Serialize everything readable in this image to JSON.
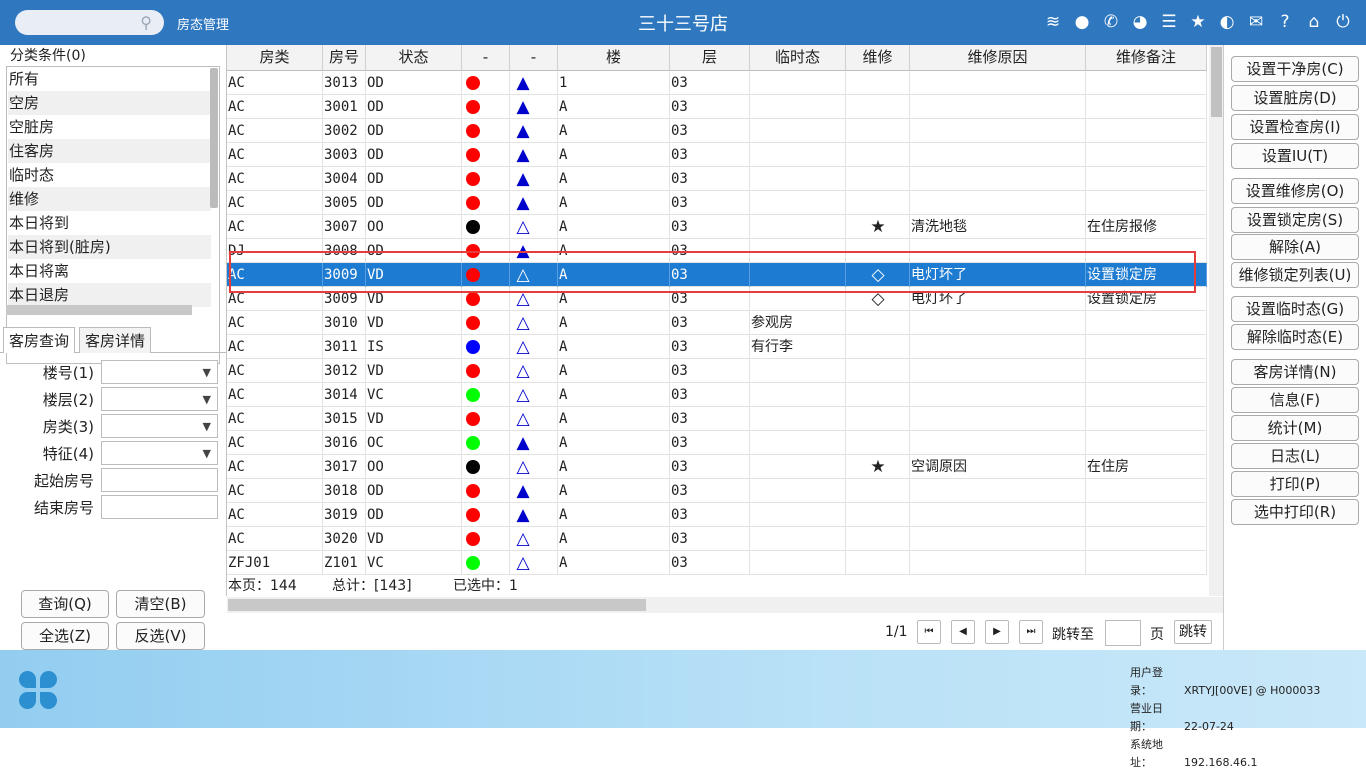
{
  "topbar": {
    "search_placeholder": "",
    "module": "房态管理",
    "store_name": "三十三号店",
    "icons": [
      "wifi-icon",
      "chat-icon",
      "phone-icon",
      "palette-icon",
      "menu-icon",
      "star-icon",
      "theme-icon",
      "mail-icon",
      "help-icon",
      "home-icon",
      "power-icon"
    ]
  },
  "categories": {
    "title": "分类条件(0)",
    "items": [
      "所有",
      "空房",
      "空脏房",
      "住客房",
      "临时态",
      "维修",
      "本日将到",
      "本日将到(脏房)",
      "本日将离",
      "本日退房"
    ]
  },
  "tabs": [
    "客房查询",
    "客房详情"
  ],
  "filters": {
    "building": "楼号(1)",
    "floor": "楼层(2)",
    "room_type": "房类(3)",
    "feature": "特征(4)",
    "start_room": "起始房号",
    "end_room": "结束房号"
  },
  "buttons": {
    "query": "查询(Q)",
    "clear": "清空(B)",
    "select_all": "全选(Z)",
    "invert": "反选(V)"
  },
  "grid": {
    "columns": [
      "房类",
      "房号",
      "状态",
      "-",
      "-",
      "楼",
      "层",
      "临时态",
      "维修",
      "维修原因",
      "维修备注"
    ],
    "rows": [
      {
        "type": "AC",
        "room": "3013",
        "status": "OD",
        "dot": "#ff0000",
        "tri": "filled",
        "bld": "1",
        "floor": "03",
        "temp": "",
        "repair": "",
        "reason": "",
        "note": ""
      },
      {
        "type": "AC",
        "room": "3001",
        "status": "OD",
        "dot": "#ff0000",
        "tri": "filled",
        "bld": "A",
        "floor": "03",
        "temp": "",
        "repair": "",
        "reason": "",
        "note": ""
      },
      {
        "type": "AC",
        "room": "3002",
        "status": "OD",
        "dot": "#ff0000",
        "tri": "filled",
        "bld": "A",
        "floor": "03",
        "temp": "",
        "repair": "",
        "reason": "",
        "note": ""
      },
      {
        "type": "AC",
        "room": "3003",
        "status": "OD",
        "dot": "#ff0000",
        "tri": "filled",
        "bld": "A",
        "floor": "03",
        "temp": "",
        "repair": "",
        "reason": "",
        "note": ""
      },
      {
        "type": "AC",
        "room": "3004",
        "status": "OD",
        "dot": "#ff0000",
        "tri": "filled",
        "bld": "A",
        "floor": "03",
        "temp": "",
        "repair": "",
        "reason": "",
        "note": ""
      },
      {
        "type": "AC",
        "room": "3005",
        "status": "OD",
        "dot": "#ff0000",
        "tri": "filled",
        "bld": "A",
        "floor": "03",
        "temp": "",
        "repair": "",
        "reason": "",
        "note": ""
      },
      {
        "type": "AC",
        "room": "3007",
        "status": "OO",
        "dot": "#000000",
        "tri": "outline",
        "bld": "A",
        "floor": "03",
        "temp": "",
        "repair": "★",
        "reason": "清洗地毯",
        "note": "在住房报修"
      },
      {
        "type": "DJ",
        "room": "3008",
        "status": "OD",
        "dot": "#ff0000",
        "tri": "filled",
        "bld": "A",
        "floor": "03",
        "temp": "",
        "repair": "",
        "reason": "",
        "note": ""
      },
      {
        "type": "AC",
        "room": "3009",
        "status": "VD",
        "dot": "#ff0000",
        "tri": "outline",
        "bld": "A",
        "floor": "03",
        "temp": "",
        "repair": "◇",
        "reason": "电灯坏了",
        "note": "设置锁定房",
        "selected": true
      },
      {
        "type": "AC",
        "room": "3009",
        "status": "VD",
        "dot": "#ff0000",
        "tri": "outline",
        "bld": "A",
        "floor": "03",
        "temp": "",
        "repair": "◇",
        "reason": "电灯坏了",
        "note": "设置锁定房"
      },
      {
        "type": "AC",
        "room": "3010",
        "status": "VD",
        "dot": "#ff0000",
        "tri": "outline",
        "bld": "A",
        "floor": "03",
        "temp": "参观房",
        "repair": "",
        "reason": "",
        "note": ""
      },
      {
        "type": "AC",
        "room": "3011",
        "status": "IS",
        "dot": "#0000ff",
        "tri": "outline",
        "bld": "A",
        "floor": "03",
        "temp": "有行李",
        "repair": "",
        "reason": "",
        "note": ""
      },
      {
        "type": "AC",
        "room": "3012",
        "status": "VD",
        "dot": "#ff0000",
        "tri": "outline",
        "bld": "A",
        "floor": "03",
        "temp": "",
        "repair": "",
        "reason": "",
        "note": ""
      },
      {
        "type": "AC",
        "room": "3014",
        "status": "VC",
        "dot": "#00ff00",
        "tri": "outline",
        "bld": "A",
        "floor": "03",
        "temp": "",
        "repair": "",
        "reason": "",
        "note": ""
      },
      {
        "type": "AC",
        "room": "3015",
        "status": "VD",
        "dot": "#ff0000",
        "tri": "outline",
        "bld": "A",
        "floor": "03",
        "temp": "",
        "repair": "",
        "reason": "",
        "note": ""
      },
      {
        "type": "AC",
        "room": "3016",
        "status": "OC",
        "dot": "#00ff00",
        "tri": "filled",
        "bld": "A",
        "floor": "03",
        "temp": "",
        "repair": "",
        "reason": "",
        "note": ""
      },
      {
        "type": "AC",
        "room": "3017",
        "status": "OO",
        "dot": "#000000",
        "tri": "outline",
        "bld": "A",
        "floor": "03",
        "temp": "",
        "repair": "★",
        "reason": "空调原因",
        "note": "在住房"
      },
      {
        "type": "AC",
        "room": "3018",
        "status": "OD",
        "dot": "#ff0000",
        "tri": "filled",
        "bld": "A",
        "floor": "03",
        "temp": "",
        "repair": "",
        "reason": "",
        "note": ""
      },
      {
        "type": "AC",
        "room": "3019",
        "status": "OD",
        "dot": "#ff0000",
        "tri": "filled",
        "bld": "A",
        "floor": "03",
        "temp": "",
        "repair": "",
        "reason": "",
        "note": ""
      },
      {
        "type": "AC",
        "room": "3020",
        "status": "VD",
        "dot": "#ff0000",
        "tri": "outline",
        "bld": "A",
        "floor": "03",
        "temp": "",
        "repair": "",
        "reason": "",
        "note": ""
      },
      {
        "type": "ZFJ01",
        "room": "Z101",
        "status": "VC",
        "dot": "#00ff00",
        "tri": "outline",
        "bld": "A",
        "floor": "03",
        "temp": "",
        "repair": "",
        "reason": "",
        "note": ""
      }
    ],
    "footer": {
      "page": "本页：144",
      "total": "总计：[143]",
      "selected": "已选中：1"
    }
  },
  "pager": {
    "page_info": "1/1",
    "jump_label": "跳转至",
    "page_unit": "页",
    "jump_button": "跳转",
    "jump_value": ""
  },
  "actions": [
    "设置干净房(C)",
    "设置脏房(D)",
    "设置检查房(I)",
    "设置IU(T)",
    "设置维修房(O)",
    "设置锁定房(S)",
    "解除(A)",
    "维修锁定列表(U)",
    "设置临时态(G)",
    "解除临时态(E)",
    "客房详情(N)",
    "信息(F)",
    "统计(M)",
    "日志(L)",
    "打印(P)",
    "选中打印(R)"
  ],
  "status": {
    "user_label": "用户登录：",
    "user": "XRTYJ[00VE] @ H000033",
    "date_label": "营业日期：",
    "date": "22-07-24",
    "addr_label": "系统地址：",
    "addr": "192.168.46.1"
  },
  "colors": {
    "accent": "#2f78c0",
    "selected_row": "#1e7bd2",
    "triangle": "#0000cc"
  }
}
